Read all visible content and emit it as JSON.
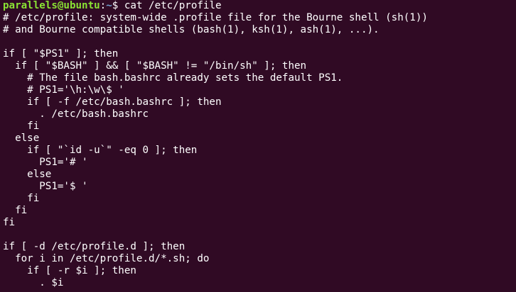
{
  "theme": {
    "background": "#300a24",
    "foreground": "#ffffff",
    "prompt_user_color": "#8ae234",
    "prompt_path_color": "#729fcf"
  },
  "prompt": {
    "user_host": "parallels@ubuntu",
    "separator": ":",
    "path": "~",
    "symbol": "$ ",
    "command": "cat /etc/profile"
  },
  "output_lines": [
    "# /etc/profile: system-wide .profile file for the Bourne shell (sh(1))",
    "# and Bourne compatible shells (bash(1), ksh(1), ash(1), ...).",
    "",
    "if [ \"$PS1\" ]; then",
    "  if [ \"$BASH\" ] && [ \"$BASH\" != \"/bin/sh\" ]; then",
    "    # The file bash.bashrc already sets the default PS1.",
    "    # PS1='\\h:\\w\\$ '",
    "    if [ -f /etc/bash.bashrc ]; then",
    "      . /etc/bash.bashrc",
    "    fi",
    "  else",
    "    if [ \"`id -u`\" -eq 0 ]; then",
    "      PS1='# '",
    "    else",
    "      PS1='$ '",
    "    fi",
    "  fi",
    "fi",
    "",
    "if [ -d /etc/profile.d ]; then",
    "  for i in /etc/profile.d/*.sh; do",
    "    if [ -r $i ]; then",
    "      . $i"
  ]
}
